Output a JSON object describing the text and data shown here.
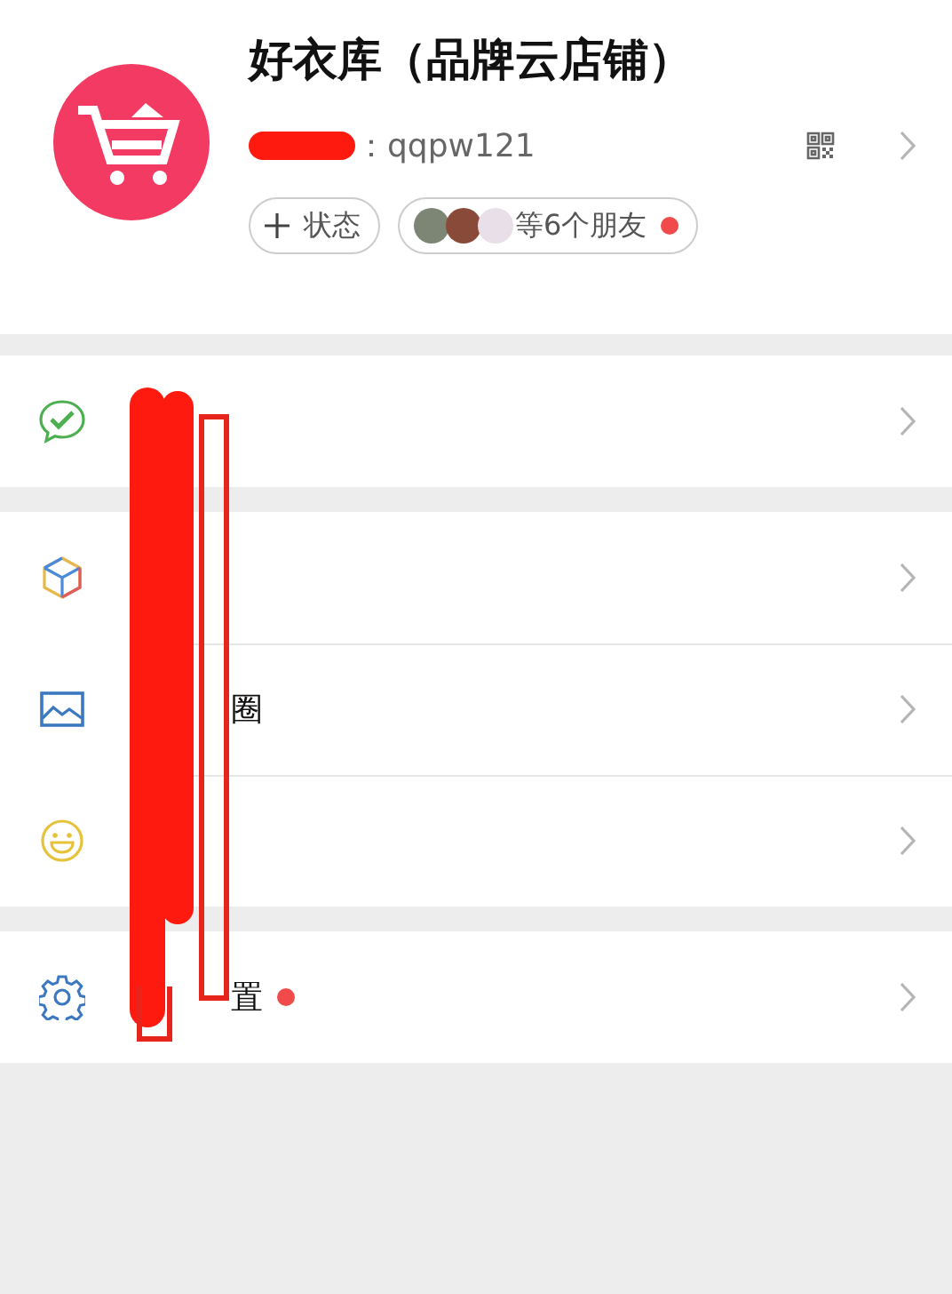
{
  "profile": {
    "name": "好衣库（品牌云店铺）",
    "id_text": "：qqpw121"
  },
  "chips": [
    {
      "kind": "add",
      "label": "状态"
    },
    {
      "kind": "friends",
      "label": "等6个朋友",
      "dot": true
    }
  ],
  "groups": [
    {
      "items": [
        {
          "kind": "pay"
        }
      ]
    },
    {
      "items": [
        {
          "kind": "cube"
        },
        {
          "kind": "image",
          "label": "圈"
        },
        {
          "kind": "smile"
        }
      ]
    },
    {
      "items": [
        {
          "kind": "gear",
          "label": "置",
          "dot": true
        }
      ]
    }
  ]
}
